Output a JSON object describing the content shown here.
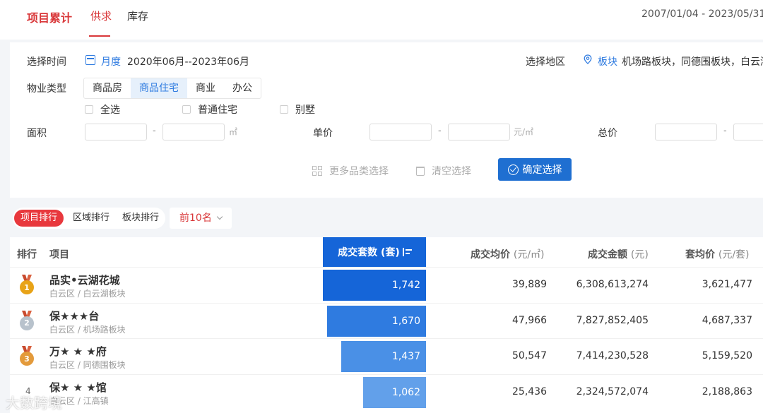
{
  "header": {
    "tabs": [
      {
        "label": "项目累计"
      },
      {
        "label": "供求"
      },
      {
        "label": "库存"
      }
    ],
    "date_range": "2007/01/04 - 2023/05/31"
  },
  "filters": {
    "time": {
      "label": "选择时间",
      "mode": "月度",
      "value": "2020年06月--2023年06月"
    },
    "region": {
      "label": "选择地区",
      "mode": "板块",
      "value": "机场路板块，同德围板块，白云湖"
    },
    "property_type": {
      "label": "物业类型",
      "options": [
        "商品房",
        "商品住宅",
        "商业",
        "办公"
      ],
      "selected": "商品住宅",
      "sub_options": [
        "全选",
        "普通住宅",
        "别墅"
      ]
    },
    "area": {
      "label": "面积",
      "unit": "㎡"
    },
    "unit_price": {
      "label": "单价",
      "unit": "元/㎡"
    },
    "total_price": {
      "label": "总价"
    },
    "actions": {
      "more": "更多品类选择",
      "clear": "清空选择",
      "confirm": "确定选择"
    }
  },
  "ranking": {
    "tabs": [
      "项目排行",
      "区域排行",
      "板块排行"
    ],
    "active_tab": "项目排行",
    "top_n": "前10名"
  },
  "table": {
    "headers": {
      "rank": "排行",
      "project": "项目",
      "deals": "成交套数 (套)",
      "avg_price_label": "成交均价",
      "avg_price_unit": "(元/㎡)",
      "amount_label": "成交金额",
      "amount_unit": "(元)",
      "unit_price_label": "套均价",
      "unit_price_unit": "(元/套)"
    },
    "rows": [
      {
        "rank": "1",
        "name": "品实•云湖花城",
        "location": "白云区 / 白云湖板块",
        "deals": "1,742",
        "deals_num": 1742,
        "avg_price": "39,889",
        "amount": "6,308,613,274",
        "unit_price": "3,621,477",
        "medal_color": "#e8a317"
      },
      {
        "rank": "2",
        "name": "保★★★台",
        "location": "白云区 / 机场路板块",
        "deals": "1,670",
        "deals_num": 1670,
        "avg_price": "47,966",
        "amount": "7,827,852,405",
        "unit_price": "4,687,337",
        "medal_color": "#b8c2cc"
      },
      {
        "rank": "3",
        "name": "万★ ★ ★府",
        "location": "白云区 / 同德围板块",
        "deals": "1,437",
        "deals_num": 1437,
        "avg_price": "50,547",
        "amount": "7,414,230,528",
        "unit_price": "5,159,520",
        "medal_color": "#e39a3b"
      },
      {
        "rank": "4",
        "name": "保★ ★ ★馆",
        "location": "白云区 / 江高镇",
        "deals": "1,062",
        "deals_num": 1062,
        "avg_price": "25,436",
        "amount": "2,324,572,074",
        "unit_price": "2,188,863",
        "medal_color": ""
      }
    ],
    "bar_colors": [
      "#1565d8",
      "#2f7be0",
      "#4a90e6",
      "#62a0ea"
    ]
  },
  "watermark": "大数跨境"
}
